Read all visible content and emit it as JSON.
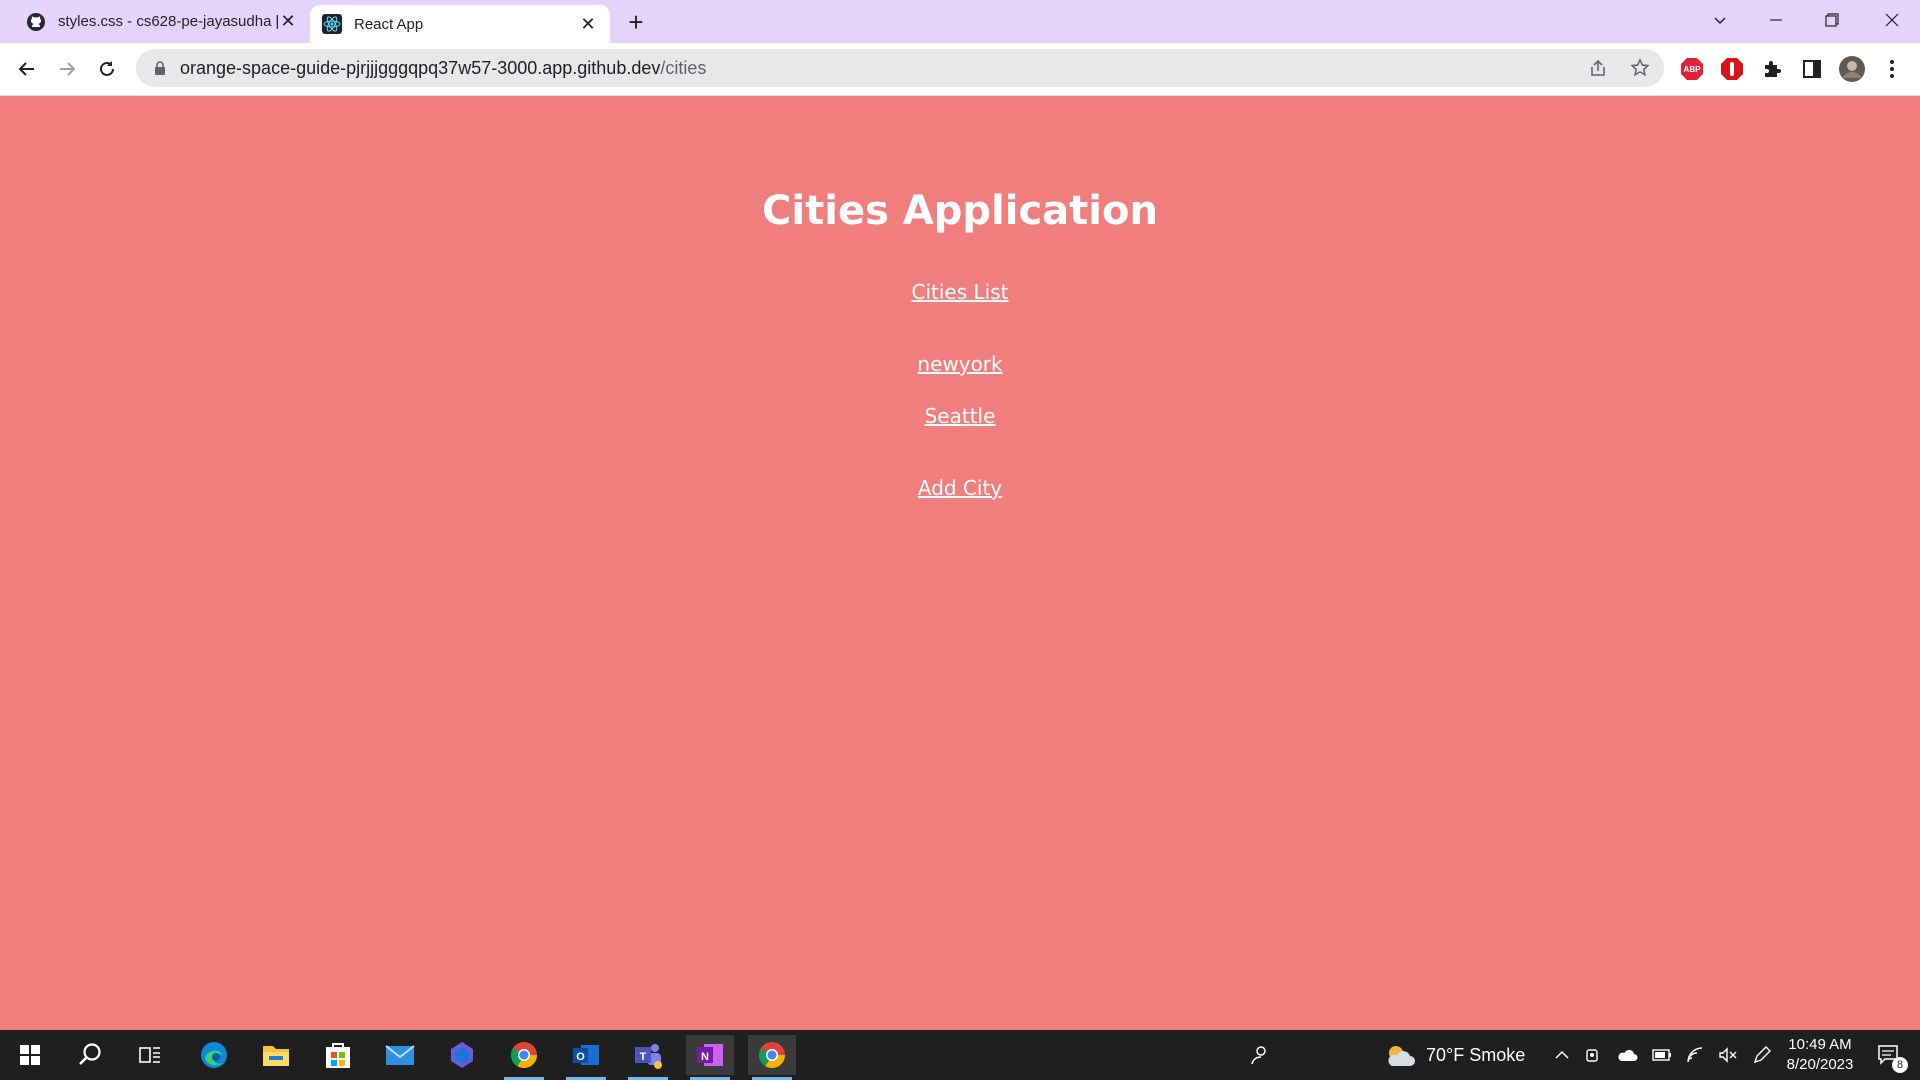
{
  "browser": {
    "tabs": [
      {
        "title": "styles.css - cs628-pe-jayasudha [",
        "favicon": "github-icon",
        "active": false
      },
      {
        "title": "React App",
        "favicon": "react-icon",
        "active": true
      }
    ],
    "url": {
      "host": "orange-space-guide-pjrjjjgggqpq37w57-3000.app.github.dev",
      "path": "/cities"
    },
    "extensions": [
      "adblock-icon",
      "extension-red-icon",
      "puzzle-icon",
      "sidepanel-icon",
      "profile-avatar"
    ]
  },
  "page": {
    "title": "Cities Application",
    "nav_link": "Cities List",
    "cities": [
      "newyork",
      "Seattle"
    ],
    "add_link": "Add City",
    "background": "#f07e7c"
  },
  "taskbar": {
    "weather": "70°F  Smoke",
    "time": "10:49 AM",
    "date": "8/20/2023",
    "notifications": "8"
  }
}
